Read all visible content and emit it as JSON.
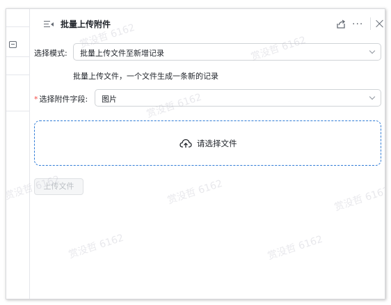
{
  "panel": {
    "title": "批量上传附件",
    "close_label": "✕"
  },
  "form": {
    "mode_label": "选择模式:",
    "mode_value": "批量上传文件至新增记录",
    "mode_hint": "批量上传文件，一个文件生成一条新的记录",
    "field_required": "*",
    "field_label": "选择附件字段:",
    "field_value": "图片"
  },
  "dropzone": {
    "text": "请选择文件"
  },
  "upload_button": "上传文件",
  "watermarks": [
    "赏没哲 6162",
    "赏没哲 6162",
    "赏没哲 6162",
    "赏没哲 6162",
    "赏没哲 6162",
    "赏没哲 6162",
    "赏没哲 6162",
    "赏没哲 6162"
  ],
  "colors": {
    "accent": "#2e7bd6",
    "required": "#f54a45"
  }
}
